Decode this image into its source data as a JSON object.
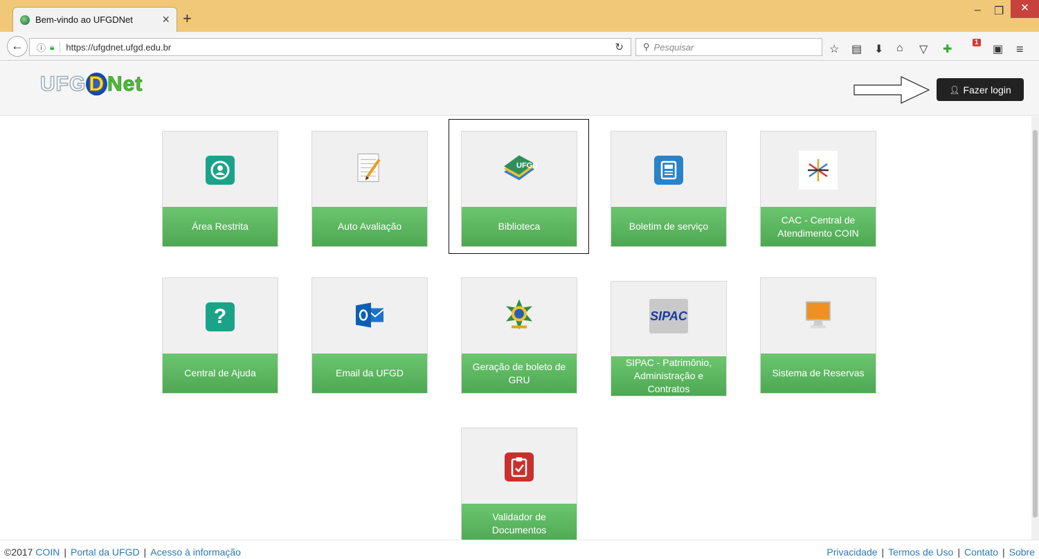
{
  "browser": {
    "tab_title": "Bem-vindo ao UFGDNet",
    "url": "https://ufgdnet.ufgd.edu.br",
    "search_placeholder": "Pesquisar",
    "notification_count": "1"
  },
  "header": {
    "logo_u": "UFG",
    "logo_d": "D",
    "logo_n": "Net",
    "login_label": "Fazer login"
  },
  "tiles": [
    {
      "label": "Área Restrita"
    },
    {
      "label": "Auto Avaliação"
    },
    {
      "label": "Biblioteca"
    },
    {
      "label": "Boletim de serviço"
    },
    {
      "label": "CAC - Central de Atendimento COIN"
    },
    {
      "label": "Central de Ajuda"
    },
    {
      "label": "Email da UFGD"
    },
    {
      "label": "Geração de boleto de GRU"
    },
    {
      "label": "SIPAC - Patrimônio, Administração e Contratos"
    },
    {
      "label": "Sistema de Reservas"
    },
    {
      "label": "Validador de Documentos"
    }
  ],
  "icons": {
    "sipac_text": "SIPAC",
    "ufgd_text": "UFGD"
  },
  "footer": {
    "copyright": "©2017",
    "left_links": [
      "COIN",
      "Portal da UFGD",
      "Acesso à informação"
    ],
    "right_links": [
      "Privacidade",
      "Termos de Uso",
      "Contato",
      "Sobre"
    ]
  }
}
